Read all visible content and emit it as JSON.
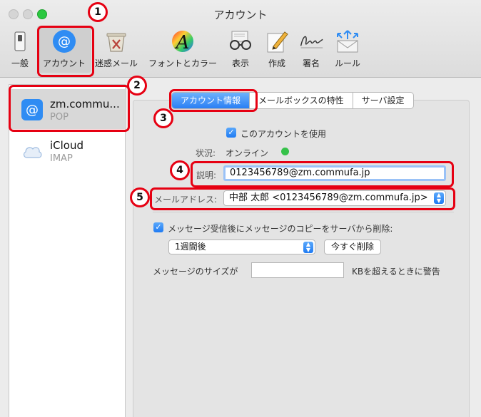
{
  "window": {
    "title": "アカウント"
  },
  "toolbar": {
    "general": "一般",
    "accounts": "アカウント",
    "junk": "迷惑メール",
    "fonts": "フォントとカラー",
    "view": "表示",
    "compose": "作成",
    "signatures": "署名",
    "rules": "ルール"
  },
  "sidebar": {
    "accounts": [
      {
        "name": "zm.commu...",
        "type": "POP"
      },
      {
        "name": "iCloud",
        "type": "IMAP"
      }
    ]
  },
  "tabs": [
    "アカウント情報",
    "メールボックスの特性",
    "サーバ設定"
  ],
  "form": {
    "enable_label": "このアカウントを使用",
    "status_label": "状況:",
    "status_value": "オンライン",
    "desc_label": "説明:",
    "desc_value": "0123456789@zm.commufa.jp",
    "email_label": "メールアドレス:",
    "email_value": "中部 太郎 <0123456789@zm.commufa.jp>",
    "remove_copy_label": "メッセージ受信後にメッセージのコピーをサーバから削除:",
    "period_value": "1週間後",
    "delete_now_label": "今すぐ削除",
    "size_label": "メッセージのサイズが",
    "size_suffix": "KBを超えるときに警告",
    "size_value": ""
  },
  "annotations": [
    "1",
    "2",
    "3",
    "4",
    "5"
  ],
  "colors": {
    "accent": "#2a7ff4",
    "annotation": "#e60012",
    "online": "#36c24a"
  }
}
